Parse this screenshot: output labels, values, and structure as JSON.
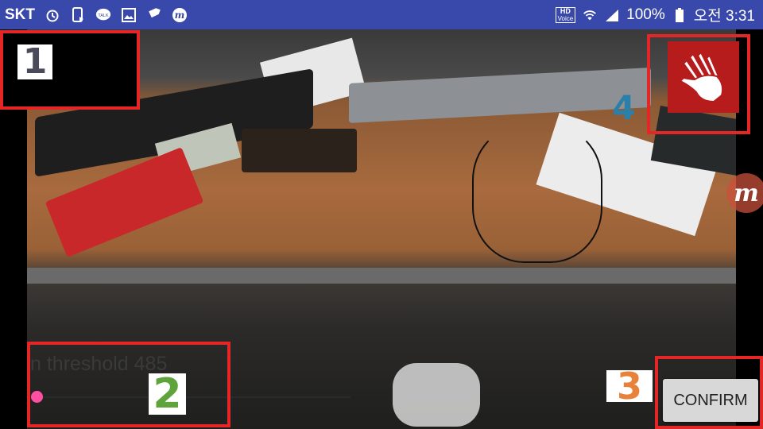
{
  "status_bar": {
    "carrier": "SKT",
    "hd_label": "HD",
    "hd_sub": "Voice",
    "battery_percent": "100%",
    "time": "오전 3:31",
    "icons_left": [
      "alarm-icon",
      "phone-sync-icon",
      "kakaotalk-icon",
      "gallery-icon",
      "tag-icon",
      "m-app-icon"
    ],
    "icons_right": [
      "hd-voice-icon",
      "wifi-icon",
      "signal-icon",
      "battery-icon"
    ],
    "talk_label": "TALK"
  },
  "overlays": {
    "num1": "1",
    "num2": "2",
    "num3": "3",
    "num4": "4"
  },
  "threshold": {
    "label": "n threshold 485"
  },
  "confirm_button": {
    "label": "CONFIRM"
  },
  "floating_icon": {
    "label": "m"
  },
  "colors": {
    "status_bar": "#3949ab",
    "highlight": "#e52627",
    "hand_button": "#b71c1c",
    "slider_thumb": "#ff4fa3"
  }
}
